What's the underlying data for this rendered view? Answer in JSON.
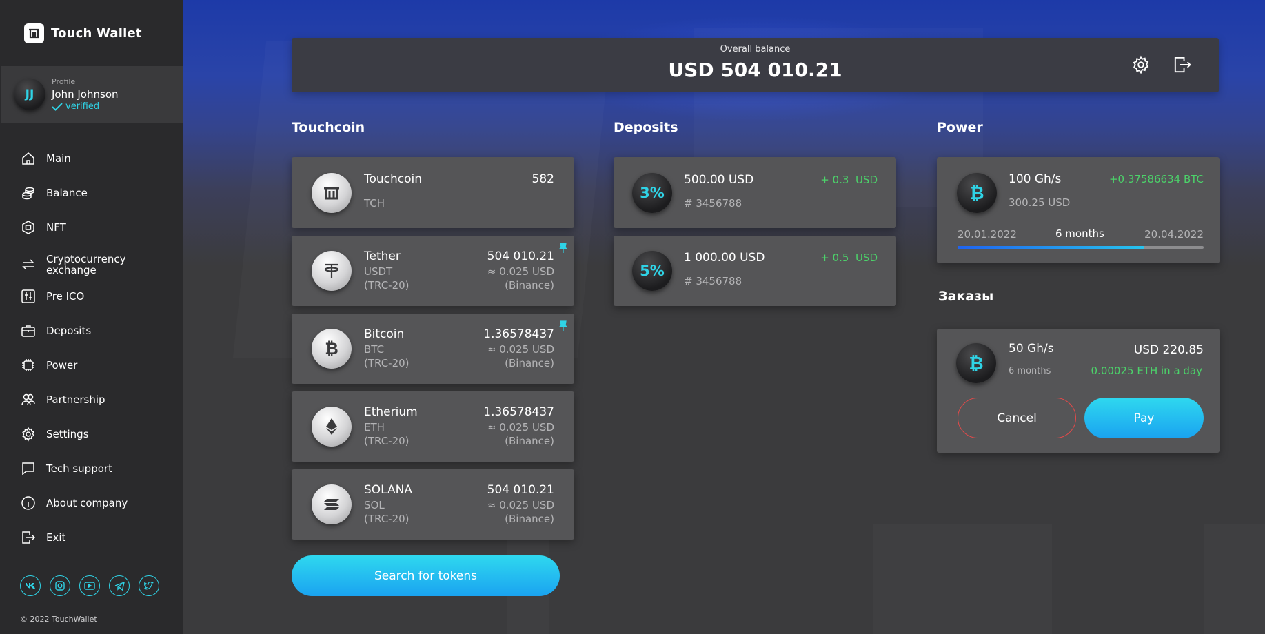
{
  "app": {
    "name": "Touch Wallet"
  },
  "profile": {
    "caption": "Profile",
    "initials": "JJ",
    "name": "John Johnson",
    "status": "verified"
  },
  "nav": [
    {
      "label": "Main",
      "icon": "home-icon"
    },
    {
      "label": "Balance",
      "icon": "coins-icon"
    },
    {
      "label": "NFT",
      "icon": "nft-icon"
    },
    {
      "label": "Cryptocurrency exchange",
      "icon": "exchange-icon"
    },
    {
      "label": "Pre ICO",
      "icon": "pre-ico-icon"
    },
    {
      "label": "Deposits",
      "icon": "briefcase-icon"
    },
    {
      "label": "Power",
      "icon": "chip-icon"
    },
    {
      "label": "Partnership",
      "icon": "partnership-icon"
    },
    {
      "label": "Settings",
      "icon": "gear-icon"
    },
    {
      "label": "Tech support",
      "icon": "chat-icon"
    },
    {
      "label": "About company",
      "icon": "info-icon"
    },
    {
      "label": "Exit",
      "icon": "exit-icon"
    }
  ],
  "socials": [
    "vk-icon",
    "instagram-icon",
    "youtube-icon",
    "telegram-icon",
    "twitter-icon"
  ],
  "copyright": "© 2022 TouchWallet",
  "header": {
    "balance_caption": "Overall balance",
    "balance_value": "USD 504 010.21"
  },
  "touchcoin": {
    "title": "Touchcoin",
    "main": {
      "name": "Touchcoin",
      "symbol": "TCH",
      "amount": "582"
    },
    "tokens": [
      {
        "name": "Tether",
        "symbol": "USDT",
        "network": "(TRC-20)",
        "amount": "504 010.21",
        "approx": "≈ 0.025 USD",
        "exchange": "(Binance)",
        "pinned": true,
        "icon": "tether-icon"
      },
      {
        "name": "Bitcoin",
        "symbol": "BTC",
        "network": "(TRC-20)",
        "amount": "1.36578437",
        "approx": "≈ 0.025 USD",
        "exchange": "(Binance)",
        "pinned": true,
        "icon": "bitcoin-icon"
      },
      {
        "name": "Etherium",
        "symbol": "ETH",
        "network": "(TRC-20)",
        "amount": "1.36578437",
        "approx": "≈ 0.025 USD",
        "exchange": "(Binance)",
        "pinned": false,
        "icon": "ethereum-icon"
      },
      {
        "name": "SOLANA",
        "symbol": "SOL",
        "network": "(TRC-20)",
        "amount": "504 010.21",
        "approx": "≈ 0.025 USD",
        "exchange": "(Binance)",
        "pinned": false,
        "icon": "solana-icon"
      }
    ],
    "search_label": "Search for tokens"
  },
  "deposits": {
    "title": "Deposits",
    "items": [
      {
        "rate": "3%",
        "amount": "500.00 USD",
        "id": "# 3456788",
        "gain": "+ 0.3  USD"
      },
      {
        "rate": "5%",
        "amount": "1 000.00 USD",
        "id": "# 3456788",
        "gain": "+ 0.5  USD"
      }
    ]
  },
  "power": {
    "title": "Power",
    "hashrate": "100 Gh/s",
    "reward": "+0.37586634 BTC",
    "cost": "300.25 USD",
    "start": "20.01.2022",
    "duration": "6 months",
    "end": "20.04.2022",
    "progress": 0.76
  },
  "orders": {
    "title": "Заказы",
    "hashrate": "50 Gh/s",
    "duration": "6 months",
    "price": "USD 220.85",
    "daily": "0.00025 ETH in a day",
    "cancel_label": "Cancel",
    "pay_label": "Pay"
  },
  "colors": {
    "accent": "#2fd3e6",
    "positive": "#4cd26a",
    "danger": "#e34a4a",
    "card": "#555557",
    "sidebar": "#2a2a2c"
  }
}
